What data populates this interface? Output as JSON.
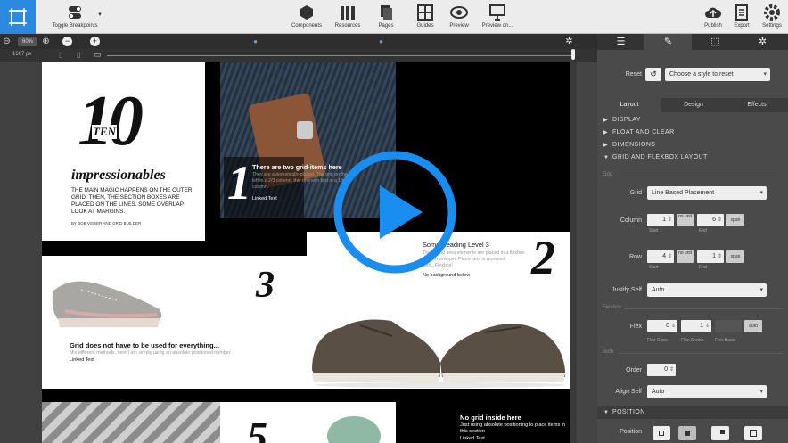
{
  "toolbar": {
    "toggle_breakpoints": "Toggle Breakpoints",
    "components": "Components",
    "resources": "Resources",
    "pages": "Pages",
    "guides": "Guides",
    "preview": "Preview",
    "preview_on": "Preview on...",
    "publish": "Publish",
    "export": "Export",
    "settings": "Settings"
  },
  "zoom": {
    "value": "60%",
    "width": "1607 px"
  },
  "canvas": {
    "p1": {
      "num": "10",
      "ten": "TEN",
      "title": "impressionables",
      "body": "THE MAIN MAGIC HAPPENS ON THE OUTER GRID. THEN, THE SECTION BOXES ARE PLACED ON THE LINES. SOME OVERLAP LOOK AT MARGINS.",
      "byline": "BY BOB VISSER AND GRID BUILDER"
    },
    "p2": {
      "num": "1",
      "title": "There are two grid-items here",
      "body": "They are automatically placed. The one on the left in a 2/3 column, this one with text in a 1fr column.",
      "link": "Linked Text"
    },
    "p3": {
      "num": "3",
      "title": "Grid does not have to be used for everything...",
      "body": "Mix different methods, here I am simply using an absolute positioned number.",
      "link": "Linked Text"
    },
    "p4": {
      "num": "2",
      "title": "Some Heading Level 3",
      "body": "These grid area elements are placed in a flexbox section wrapper. Placement is reversed with...Flexbox!",
      "note": "No background below"
    },
    "p5": {
      "num": "5"
    },
    "p7": {
      "title": "No grid inside here",
      "body": "Just using absolute positioning to place items in this section",
      "link": "Linked Text"
    }
  },
  "panel": {
    "reset_label": "Reset",
    "reset_select": "Choose a style to reset",
    "tabs": [
      "Layout",
      "Design",
      "Effects"
    ],
    "sections": [
      "DISPLAY",
      "FLOAT AND CLEAR",
      "DIMENSIONS",
      "GRID AND FLEXBOX LAYOUT"
    ],
    "grid_header": "Grid",
    "grid_label": "Grid",
    "grid_value": "Line Based Placement",
    "column_label": "Column",
    "column_start": "1",
    "column_end": "6",
    "row_label": "Row",
    "row_start": "4",
    "row_end": "1",
    "no_unit": "no unit",
    "span": "span",
    "start": "Start",
    "end": "End",
    "justify_label": "Justify Self",
    "justify_value": "Auto",
    "flexbox_header": "Flexbox",
    "flex_label": "Flex",
    "flex_grow": "0",
    "flex_shrink": "1",
    "flex_grow_label": "Flex Grow",
    "flex_shrink_label": "Flex Shrink",
    "flex_basis_label": "Flex Basis",
    "auto": "auto",
    "both_header": "Both",
    "order_label": "Order",
    "order_value": "0",
    "align_label": "Align Self",
    "align_value": "Auto",
    "position_section": "POSITION",
    "position_label": "Position"
  },
  "colors": {
    "accent": "#2a8ae0",
    "play": "#1a8ef0"
  }
}
